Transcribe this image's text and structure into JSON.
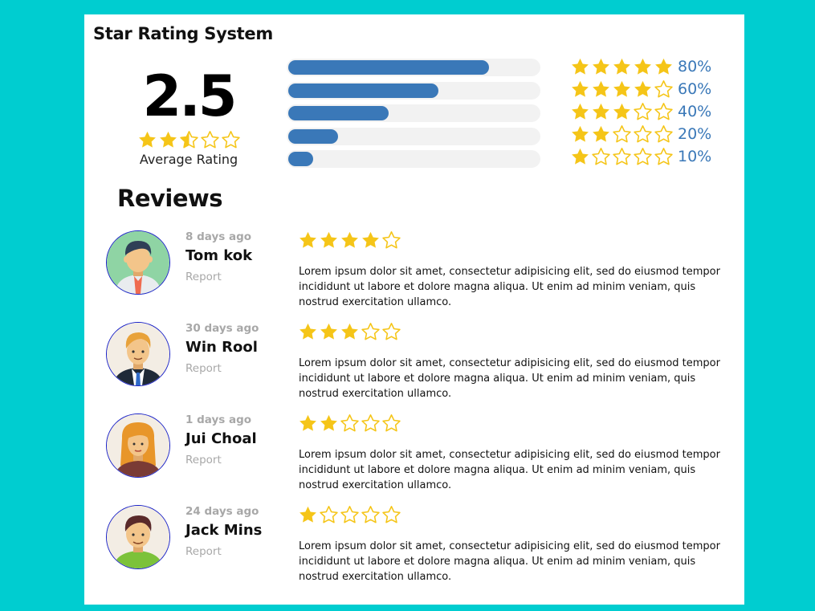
{
  "page": {
    "title": "Star Rating System"
  },
  "summary": {
    "average": "2.5",
    "average_stars": 2.5,
    "label": "Average Rating"
  },
  "distribution": [
    {
      "stars": 5,
      "percent": "80%",
      "fill": 0.8
    },
    {
      "stars": 4,
      "percent": "60%",
      "fill": 0.6
    },
    {
      "stars": 3,
      "percent": "40%",
      "fill": 0.4
    },
    {
      "stars": 2,
      "percent": "20%",
      "fill": 0.2
    },
    {
      "stars": 1,
      "percent": "10%",
      "fill": 0.1
    }
  ],
  "reviews_heading": "Reviews",
  "reviews": [
    {
      "time": "8 days ago",
      "name": "Tom kok",
      "report": "Report",
      "rating": 4,
      "avatar": "avatar-man-tie-icon",
      "text": "Lorem ipsum dolor sit amet, consectetur adipisicing elit, sed do eiusmod tempor incididunt ut labore et dolore magna aliqua. Ut enim ad minim veniam, quis nostrud exercitation ullamco."
    },
    {
      "time": "30 days ago",
      "name": "Win Rool",
      "report": "Report",
      "rating": 3,
      "avatar": "avatar-man-suit-icon",
      "text": "Lorem ipsum dolor sit amet, consectetur adipisicing elit, sed do eiusmod tempor incididunt ut labore et dolore magna aliqua. Ut enim ad minim veniam, quis nostrud exercitation ullamco."
    },
    {
      "time": "1 days ago",
      "name": "Jui Choal",
      "report": "Report",
      "rating": 2,
      "avatar": "avatar-woman-icon",
      "text": "Lorem ipsum dolor sit amet, consectetur adipisicing elit, sed do eiusmod tempor incididunt ut labore et dolore magna aliqua. Ut enim ad minim veniam, quis nostrud exercitation ullamco."
    },
    {
      "time": "24 days ago",
      "name": "Jack Mins",
      "report": "Report",
      "rating": 1,
      "avatar": "avatar-man-green-shirt-icon",
      "text": "Lorem ipsum dolor sit amet, consectetur adipisicing elit, sed do eiusmod tempor incididunt ut labore et dolore magna aliqua. Ut enim ad minim veniam, quis nostrud exercitation ullamco."
    }
  ],
  "colors": {
    "background": "#00cdd0",
    "star": "#f5c518",
    "bar": "#3a78b8",
    "bar_track": "#f2f2f2",
    "muted_text": "#a8a8a8",
    "avatar_border": "#1a22c8"
  }
}
